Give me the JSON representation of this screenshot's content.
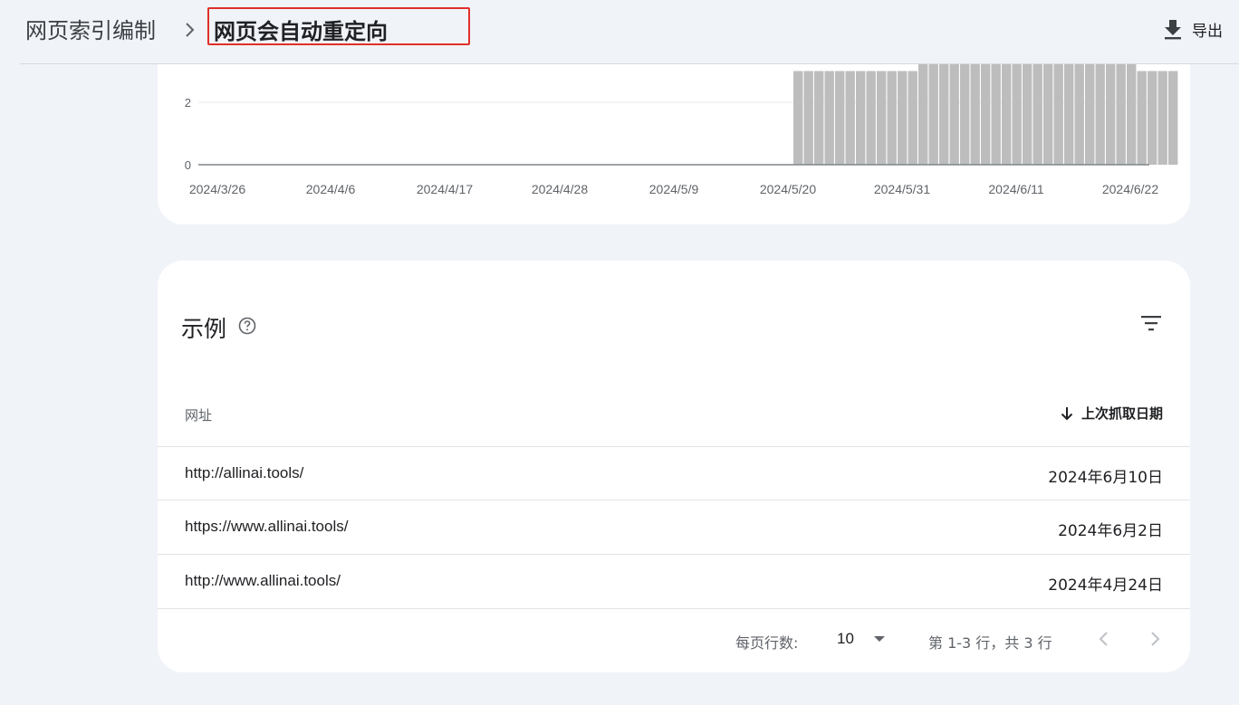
{
  "header": {
    "breadcrumb_parent": "网页索引编制",
    "breadcrumb_current": "网页会自动重定向",
    "export_label": "导出",
    "highlight_color": "#e0302a"
  },
  "chart_data": {
    "type": "bar",
    "x_tick_labels": [
      "2024/3/26",
      "2024/4/6",
      "2024/4/17",
      "2024/4/28",
      "2024/5/9",
      "2024/5/20",
      "2024/5/31",
      "2024/6/11",
      "2024/6/22"
    ],
    "y_tick_labels": [
      "0",
      "2"
    ],
    "bar_color": "#bdbdbd",
    "start_date": "2024/5/20",
    "values": [
      3,
      3,
      3,
      3,
      3,
      3,
      3,
      3,
      3,
      3,
      3,
      3,
      4,
      4,
      4,
      4,
      4,
      4,
      4,
      4,
      4,
      4,
      4,
      4,
      4,
      4,
      4,
      4,
      4,
      4,
      4,
      4,
      4,
      3,
      3,
      3,
      3
    ],
    "note_values": "bars before 2024/5/20 are 0"
  },
  "examples": {
    "title": "示例",
    "col_url": "网址",
    "col_date": "上次抓取日期",
    "rows": [
      {
        "url": "http://allinai.tools/",
        "date": "2024年6月10日"
      },
      {
        "url": "https://www.allinai.tools/",
        "date": "2024年6月2日"
      },
      {
        "url": "http://www.allinai.tools/",
        "date": "2024年4月24日"
      }
    ],
    "rows_per_page_label": "每页行数:",
    "rows_per_page_value": "10",
    "range_label": "第 1-3 行，共 3 行"
  }
}
